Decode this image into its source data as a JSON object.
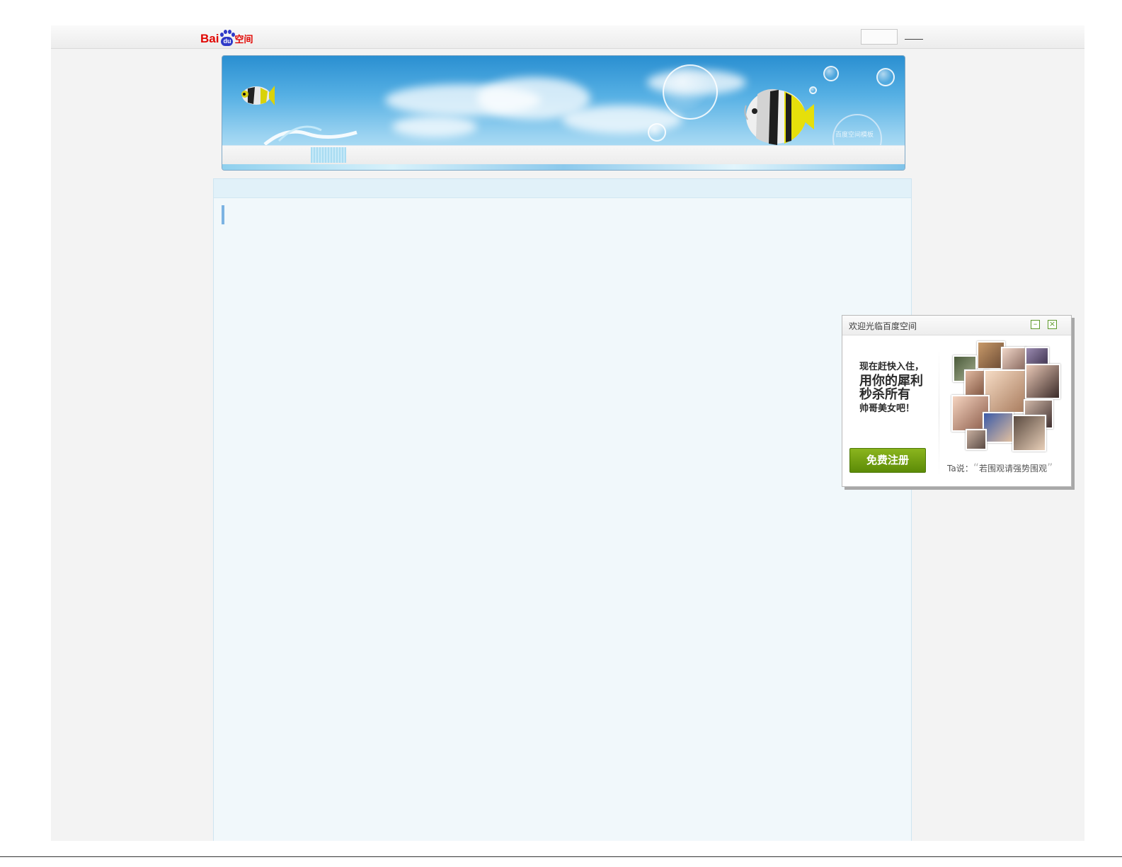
{
  "window": {
    "title": "Baidu空间"
  },
  "topbar": {
    "logo_bai": "Bai",
    "logo_du": "du",
    "logo_space": "空间"
  },
  "banner": {
    "stamp_text": "百度空间模板"
  },
  "popup": {
    "title": "欢迎光临百度空间",
    "minimize_icon": "minimize-icon",
    "close_icon": "close-icon",
    "pitch_line1": "现在赶快入住，",
    "pitch_line2": "用你的犀利",
    "pitch_line3": "秒杀所有",
    "pitch_line4": "帅哥美女吧！",
    "register_label": "免费注册",
    "quote_prefix": "Ta说：",
    "quote_open": "“",
    "quote_text": "若围观请强势围观",
    "quote_close": "”",
    "accent_color": "#5e9a2a"
  }
}
